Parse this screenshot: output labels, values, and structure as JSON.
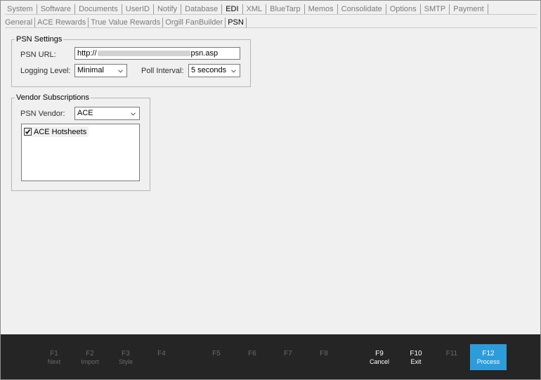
{
  "top_tabs": [
    "System",
    "Software",
    "Documents",
    "UserID",
    "Notify",
    "Database",
    "EDI",
    "XML",
    "BlueTarp",
    "Memos",
    "Consolidate",
    "Options",
    "SMTP",
    "Payment"
  ],
  "sub_tabs": [
    "General",
    "ACE Rewards",
    "True Value Rewards",
    "Orgill FanBuilder",
    "PSN"
  ],
  "psn_settings": {
    "legend": "PSN Settings",
    "url_label": "PSN URL:",
    "url_prefix": "http://",
    "url_suffix": "psn.asp",
    "logging_label": "Logging Level:",
    "logging_value": "Minimal",
    "poll_label": "Poll Interval:",
    "poll_value": "5 seconds"
  },
  "vendor": {
    "legend": "Vendor Subscriptions",
    "vendor_label": "PSN Vendor:",
    "vendor_value": "ACE",
    "items": [
      {
        "label": "ACE Hotsheets",
        "checked": true
      }
    ]
  },
  "fkeys": [
    {
      "key": "F1",
      "label": "Next"
    },
    {
      "key": "F2",
      "label": "Import"
    },
    {
      "key": "F3",
      "label": "Style"
    },
    {
      "key": "F4",
      "label": ""
    },
    {
      "key": "F5",
      "label": ""
    },
    {
      "key": "F6",
      "label": ""
    },
    {
      "key": "F7",
      "label": ""
    },
    {
      "key": "F8",
      "label": ""
    },
    {
      "key": "F9",
      "label": "Cancel"
    },
    {
      "key": "F10",
      "label": "Exit"
    },
    {
      "key": "F11",
      "label": ""
    },
    {
      "key": "F12",
      "label": "Process"
    }
  ],
  "colors": {
    "primary": "#2d9cdb",
    "footer": "#252525"
  }
}
